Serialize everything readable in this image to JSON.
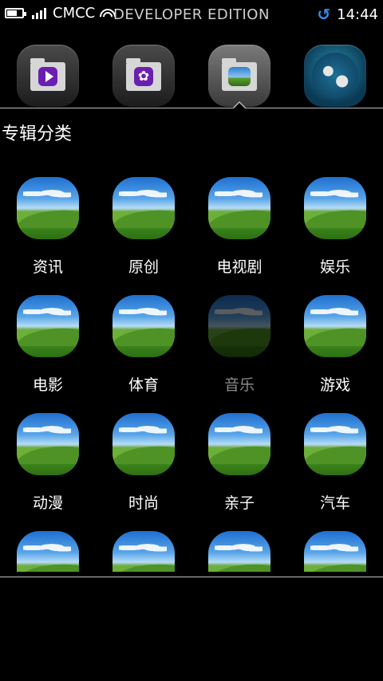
{
  "status_bar": {
    "carrier": "CMCC",
    "edition": "DEVELOPER EDITION",
    "time": "14:44",
    "battery_level": 0.6,
    "icons": [
      "battery-icon",
      "signal-icon",
      "wifi-icon",
      "sync-icon"
    ]
  },
  "app_bar": {
    "apps": [
      {
        "name": "video-app",
        "icon": "play-icon"
      },
      {
        "name": "favorites-app",
        "icon": "star-icon"
      },
      {
        "name": "gallery-app",
        "icon": "landscape-icon",
        "selected": true
      },
      {
        "name": "browser-app",
        "icon": "globe-icon"
      }
    ]
  },
  "section": {
    "title": "专辑分类"
  },
  "categories": [
    {
      "label": "资讯"
    },
    {
      "label": "原创"
    },
    {
      "label": "电视剧"
    },
    {
      "label": "娱乐"
    },
    {
      "label": "电影"
    },
    {
      "label": "体育"
    },
    {
      "label": "音乐",
      "dimmed": true
    },
    {
      "label": "游戏"
    },
    {
      "label": "动漫"
    },
    {
      "label": "时尚"
    },
    {
      "label": "亲子"
    },
    {
      "label": "汽车"
    },
    {
      "label": ""
    },
    {
      "label": ""
    },
    {
      "label": ""
    },
    {
      "label": ""
    }
  ],
  "colors": {
    "background": "#000000",
    "accent": "#2f8ef0",
    "divider": "#bdbdbd",
    "dim_label": "#8a8a8a"
  }
}
